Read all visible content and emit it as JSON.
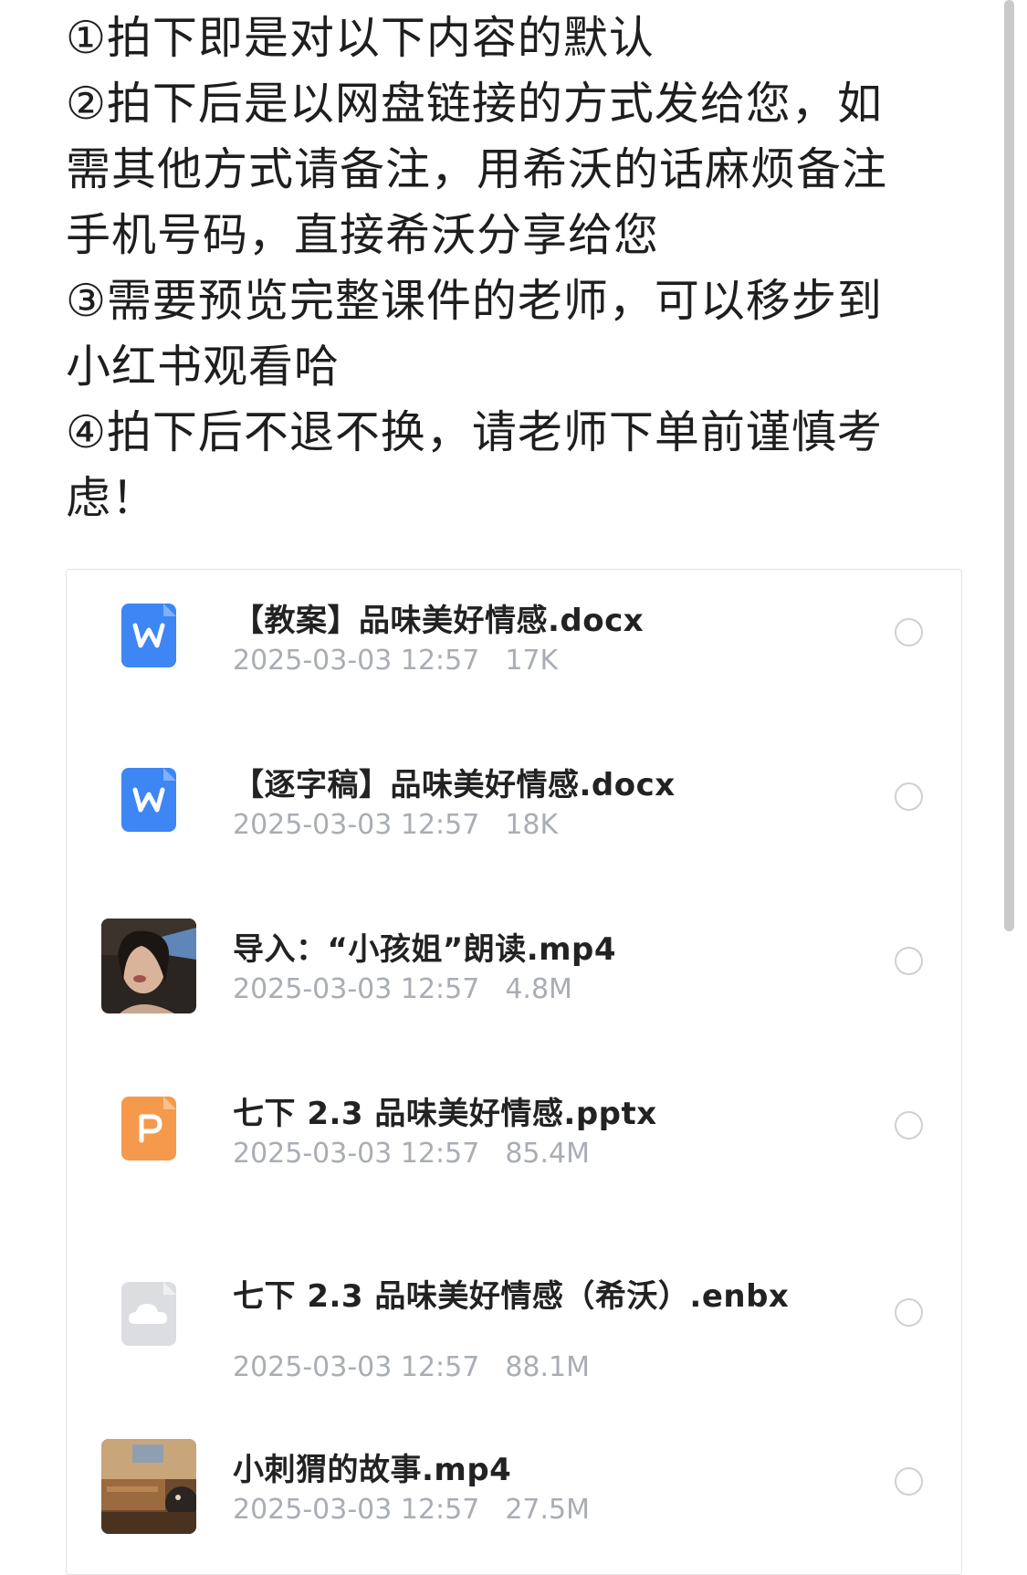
{
  "notice": {
    "lines": [
      "①拍下即是对以下内容的默认",
      "②拍下后是以网盘链接的方式发给您，如",
      "需其他方式请备注，用希沃的话麻烦备注",
      "手机号码，直接希沃分享给您",
      "③需要预览完整课件的老师，可以移步到",
      "小红书观看哈",
      "④拍下后不退不换，请老师下单前谨慎考",
      "虑！"
    ]
  },
  "files": [
    {
      "name": "【教案】品味美好情感.docx",
      "date": "2025-03-03 12:57",
      "size": "17K",
      "icon": "word-doc-icon"
    },
    {
      "name": "【逐字稿】品味美好情感.docx",
      "date": "2025-03-03 12:57",
      "size": "18K",
      "icon": "word-doc-icon"
    },
    {
      "name": "导入：“小孩姐”朗读.mp4",
      "date": "2025-03-03 12:57",
      "size": "4.8M",
      "icon": "video-thumbnail"
    },
    {
      "name": "七下 2.3 品味美好情感.pptx",
      "date": "2025-03-03 12:57",
      "size": "85.4M",
      "icon": "ppt-icon"
    },
    {
      "name": "七下 2.3 品味美好情感（希沃）.enbx",
      "date": "2025-03-03 12:57",
      "size": "88.1M",
      "icon": "cloud-file-icon"
    },
    {
      "name": "小刺猬的故事.mp4",
      "date": "2025-03-03 12:57",
      "size": "27.5M",
      "icon": "video-thumbnail"
    }
  ],
  "colors": {
    "word": "#3d86f4",
    "ppt": "#f59a4c",
    "cloud": "#dcdde0",
    "meta_text": "#a9adb4"
  }
}
